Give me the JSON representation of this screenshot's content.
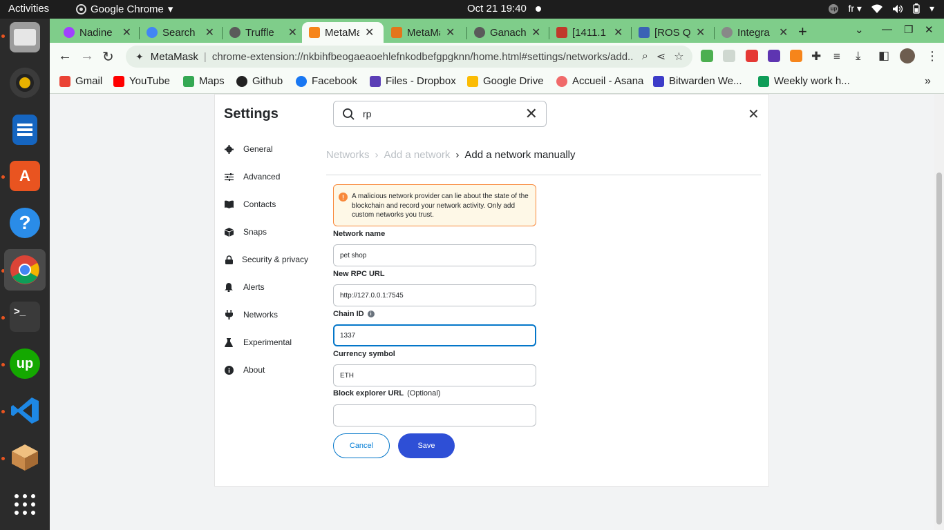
{
  "system_bar": {
    "activities": "Activities",
    "app_name": "Google Chrome",
    "clock": "Oct 21  19:40",
    "lang": "fr"
  },
  "browser": {
    "tabs": [
      {
        "label": "Nadine",
        "icon_color": "#a040ff"
      },
      {
        "label": "Search",
        "icon_color": "#4285f4"
      },
      {
        "label": "Truffle",
        "icon_color": "#5a5a5a"
      },
      {
        "label": "MetaMask",
        "icon_color": "#f6851b"
      },
      {
        "label": "MetaMask",
        "icon_color": "#e2761b"
      },
      {
        "label": "Ganache",
        "icon_color": "#5a5a5a"
      },
      {
        "label": "[1411.1",
        "icon_color": "#c0392b"
      },
      {
        "label": "[ROS Q",
        "icon_color": "#3a62b5"
      },
      {
        "label": "Integra",
        "icon_color": "#888888"
      }
    ],
    "omnibox": {
      "site": "MetaMask",
      "url": "chrome-extension://nkbihfbeogaeaoehlefnkodbefgpgknn/home.html#settings/networks/add..."
    },
    "bookmarks": [
      {
        "label": "Gmail",
        "icon_color": "#ea4335"
      },
      {
        "label": "YouTube",
        "icon_color": "#ff0000"
      },
      {
        "label": "Maps",
        "icon_color": "#34a853"
      },
      {
        "label": "Github",
        "icon_color": "#222222"
      },
      {
        "label": "Facebook",
        "icon_color": "#1877f2"
      },
      {
        "label": "Files - Dropbox",
        "icon_color": "#5b3fb6"
      },
      {
        "label": "Google Drive",
        "icon_color": "#fbbc04"
      },
      {
        "label": "Accueil - Asana",
        "icon_color": "#f06a6a"
      },
      {
        "label": "Bitwarden We...",
        "icon_color": "#3c3cc8"
      },
      {
        "label": "Weekly work h...",
        "icon_color": "#0f9d58"
      }
    ]
  },
  "settings": {
    "title": "Settings",
    "search_value": "rp",
    "menu": [
      {
        "label": "General",
        "icon": "gear-icon"
      },
      {
        "label": "Advanced",
        "icon": "sliders-icon"
      },
      {
        "label": "Contacts",
        "icon": "book-icon"
      },
      {
        "label": "Snaps",
        "icon": "cube-icon"
      },
      {
        "label": "Security & privacy",
        "icon": "lock-icon"
      },
      {
        "label": "Alerts",
        "icon": "bell-icon"
      },
      {
        "label": "Networks",
        "icon": "plug-icon"
      },
      {
        "label": "Experimental",
        "icon": "flask-icon"
      },
      {
        "label": "About",
        "icon": "info-icon"
      }
    ],
    "breadcrumb": {
      "first": "Networks",
      "second": "Add a network",
      "current": "Add a network manually"
    },
    "warning": "A malicious network provider can lie about the state of the blockchain and record your network activity. Only add custom networks you trust.",
    "form": {
      "network_name_label": "Network name",
      "network_name_value": "pet shop",
      "rpc_label": "New RPC URL",
      "rpc_value": "http://127.0.0.1:7545",
      "chain_id_label": "Chain ID",
      "chain_id_value": "1337",
      "currency_label": "Currency symbol",
      "currency_value": "ETH",
      "explorer_label": "Block explorer URL",
      "explorer_optional": "(Optional)",
      "explorer_value": ""
    },
    "cancel_label": "Cancel",
    "save_label": "Save"
  },
  "colors": {
    "chrome_frame": "#7fcd8a",
    "primary_button": "#2e4fd6",
    "warning_border": "#f8883b",
    "focus_border": "#0376c9"
  }
}
